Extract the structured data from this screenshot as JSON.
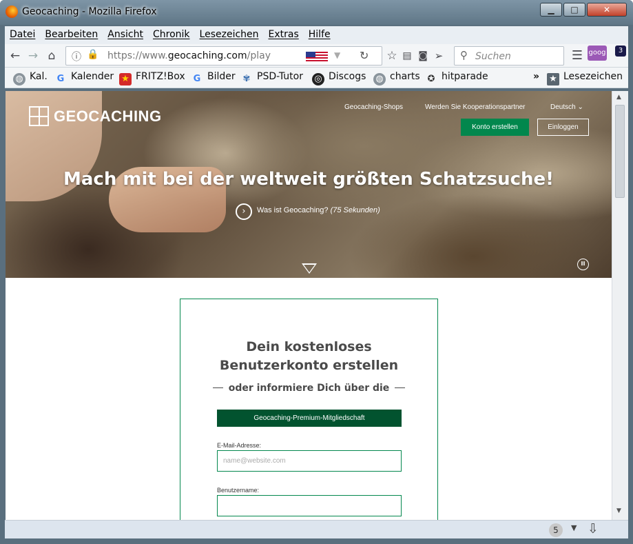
{
  "window": {
    "title": "Geocaching - Mozilla Firefox",
    "minimize": "▁",
    "maximize": "□",
    "close": "✕"
  },
  "menubar": {
    "items": [
      "Datei",
      "Bearbeiten",
      "Ansicht",
      "Chronik",
      "Lesezeichen",
      "Extras",
      "Hilfe"
    ]
  },
  "navbar": {
    "url_prefix": "https://www.",
    "url_domain": "geocaching.com",
    "url_path": "/play",
    "search_placeholder": "Suchen",
    "addon_badge": "3",
    "addon_label": "goog"
  },
  "bookmarks": {
    "items": [
      "Kal.",
      "Kalender",
      "FRITZ!Box",
      "Bilder",
      "PSD-Tutor",
      "Discogs",
      "charts",
      "hitparade"
    ],
    "overflow": "»",
    "lesezeichen": "Lesezeichen"
  },
  "page": {
    "logo": "GEOCACHING",
    "shops_link": "Geocaching-Shops",
    "partner_link": "Werden Sie Kooperationspartner",
    "language": "Deutsch",
    "create_account": "Konto erstellen",
    "login": "Einloggen",
    "headline": "Mach mit bei der weltweit größten Schatzsuche!",
    "video_text": "Was ist Geocaching?",
    "video_duration": "(75 Sekunden)",
    "card_title_line1": "Dein kostenloses",
    "card_title_line2": "Benutzerkonto erstellen",
    "card_subtitle": "oder informiere Dich über die",
    "premium_button": "Geocaching-Premium-Mitgliedschaft",
    "email_label": "E-Mail-Adresse:",
    "email_placeholder": "name@website.com",
    "username_label": "Benutzername:"
  },
  "statusbar": {
    "downloads_count": "5"
  },
  "colors": {
    "brand_green": "#02874d",
    "dark_green": "#02532f"
  }
}
